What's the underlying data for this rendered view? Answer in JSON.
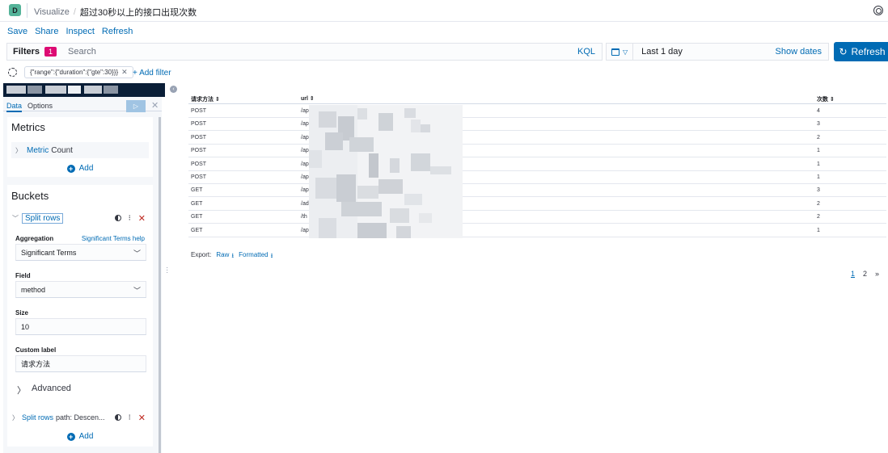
{
  "app": {
    "logo_letter": "D"
  },
  "breadcrumbs": [
    "Visualize",
    "超过30秒以上的接口出现次数"
  ],
  "breadcrumb_separator": "/",
  "menu": [
    "Save",
    "Share",
    "Inspect",
    "Refresh"
  ],
  "filterbar": {
    "label": "Filters",
    "count": "1",
    "search_placeholder": "Search",
    "kql": "KQL"
  },
  "date": {
    "label": "Last 1 day",
    "show_dates": "Show dates"
  },
  "refresh_button": "Refresh",
  "active_filter": "{\"range\":{\"duration\":{\"gte\":30}}}",
  "add_filter": "+ Add filter",
  "sidebar": {
    "tabs": [
      "Data",
      "Options"
    ],
    "metrics": {
      "title": "Metrics",
      "item_type": "Metric",
      "item_value": "Count",
      "add_label": "Add"
    },
    "buckets": {
      "title": "Buckets",
      "split_label": "Split rows",
      "aggregation_label": "Aggregation",
      "aggregation_help": "Significant Terms help",
      "aggregation_value": "Significant Terms",
      "field_label": "Field",
      "field_value": "method",
      "size_label": "Size",
      "size_value": "10",
      "custom_label_label": "Custom label",
      "custom_label_value": "请求方法",
      "advanced_label": "Advanced",
      "split2_label": "Split rows",
      "split2_desc": "path: Descen...",
      "add_label": "Add"
    }
  },
  "table": {
    "columns": [
      "请求方法",
      "url",
      "次数"
    ],
    "rows": [
      {
        "method": "POST",
        "url": "/ap",
        "count": "4"
      },
      {
        "method": "POST",
        "url": "/ap",
        "count": "3"
      },
      {
        "method": "POST",
        "url": "/ap",
        "count": "2"
      },
      {
        "method": "POST",
        "url": "/ap",
        "count": "1"
      },
      {
        "method": "POST",
        "url": "/ap",
        "count": "1"
      },
      {
        "method": "POST",
        "url": "/ap",
        "count": "1"
      },
      {
        "method": "GET",
        "url": "/ap",
        "count": "3"
      },
      {
        "method": "GET",
        "url": "/ad",
        "count": "2"
      },
      {
        "method": "GET",
        "url": "/th",
        "count": "2"
      },
      {
        "method": "GET",
        "url": "/ap",
        "count": "1"
      }
    ],
    "sort_glyph": "⇕"
  },
  "export": {
    "label": "Export:",
    "raw": "Raw",
    "formatted": "Formatted"
  },
  "pagination": {
    "pages": [
      "1",
      "2"
    ],
    "next": "»",
    "current": "1"
  },
  "colors": {
    "accent": "#006bb4",
    "badge": "#dd0a73",
    "delete": "#bd271e"
  }
}
